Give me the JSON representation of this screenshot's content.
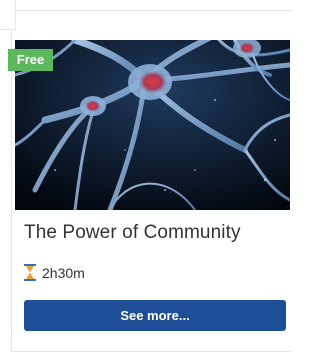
{
  "course": {
    "badge": "Free",
    "title": "The Power of Community",
    "duration": "2h30m",
    "cta_label": "See more...",
    "image_icon": "neuron-network-image",
    "duration_icon": "hourglass-icon"
  },
  "colors": {
    "badge_bg": "#5cb85c",
    "button_bg": "#1d4e96",
    "text": "#333333"
  }
}
